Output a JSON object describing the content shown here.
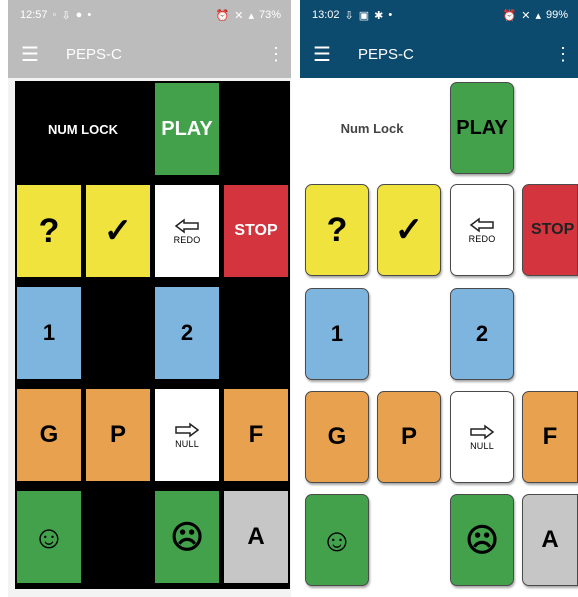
{
  "left_phone": {
    "status": {
      "time": "12:57",
      "battery": "73%"
    },
    "appbar": {
      "menu_icon": "☰",
      "title": "PEPS-C",
      "more_icon": "⋮"
    },
    "numlock_label": "NUM LOCK",
    "tiles": {
      "play": "PLAY",
      "question": "?",
      "check": "✓",
      "redo": "REDO",
      "stop": "STOP",
      "one": "1",
      "two": "2",
      "g": "G",
      "p": "P",
      "null": "NULL",
      "f": "F",
      "happy": "☺",
      "sad": "☹",
      "a": "A"
    }
  },
  "right_phone": {
    "status": {
      "time": "13:02",
      "battery": "99%"
    },
    "appbar": {
      "menu_icon": "☰",
      "title": "PEPS-C",
      "more_icon": "⋮"
    },
    "numlock_label": "Num Lock",
    "tiles": {
      "play": "PLAY",
      "question": "?",
      "check": "✓",
      "redo": "REDO",
      "stop": "STOP",
      "one": "1",
      "two": "2",
      "g": "G",
      "p": "P",
      "null": "NULL",
      "f": "F",
      "happy": "☺",
      "sad": "☹",
      "a": "A"
    }
  },
  "colors": {
    "yellow": "#f1e33d",
    "red": "#d3343e",
    "blue": "#7eb5df",
    "orange": "#e8a24f",
    "green": "#42a14a",
    "grey": "#c6c6c6",
    "left_appbar": "#bcbcbc",
    "right_appbar": "#0c4a6e"
  }
}
